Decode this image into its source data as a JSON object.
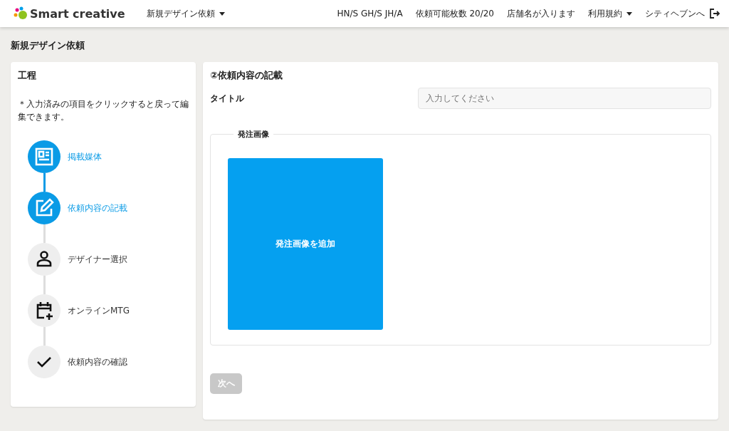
{
  "header": {
    "logo": "Smart creative",
    "menu": "新規デザイン依頼",
    "items": [
      "HN/S GH/S JH/A",
      "依頼可能枚数 20/20",
      "店舗名が入ります"
    ],
    "terms": "利用規約",
    "exit": "シティヘブンへ"
  },
  "page_title": "新規デザイン依頼",
  "steps_panel": {
    "title": "工程",
    "note": "＊入力済みの項目をクリックすると戻って編集できます。",
    "steps": [
      {
        "label": "掲載媒体",
        "kind": "media",
        "active": true
      },
      {
        "label": "依頼内容の記載",
        "kind": "edit",
        "active": true
      },
      {
        "label": "デザイナー選択",
        "kind": "person",
        "active": false
      },
      {
        "label": "オンラインMTG",
        "kind": "calendar",
        "active": false
      },
      {
        "label": "依頼内容の確認",
        "kind": "check",
        "active": false
      }
    ]
  },
  "form": {
    "title": "②依頼内容の記載",
    "title_label": "タイトル",
    "title_placeholder": "入力してください",
    "image_legend": "発注画像",
    "add_image": "発注画像を追加",
    "next": {
      "label": "次へ",
      "disabled": true
    }
  }
}
